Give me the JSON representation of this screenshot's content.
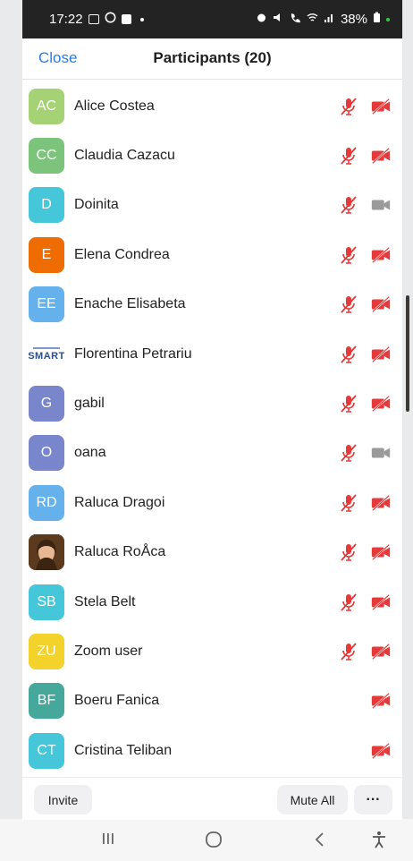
{
  "status_bar": {
    "time": "17:22",
    "battery": "38%"
  },
  "header": {
    "close_label": "Close",
    "title": "Participants (20)"
  },
  "participants": [
    {
      "initials": "AC",
      "name": "Alice Costea",
      "color": "#a6d276",
      "mic": "muted",
      "video": "off"
    },
    {
      "initials": "CC",
      "name": "Claudia Cazacu",
      "color": "#7cc47b",
      "mic": "muted",
      "video": "off"
    },
    {
      "initials": "D",
      "name": "Doinita",
      "color": "#45c6d9",
      "mic": "muted",
      "video": "on"
    },
    {
      "initials": "E",
      "name": "Elena Condrea",
      "color": "#ef6c00",
      "mic": "muted",
      "video": "off"
    },
    {
      "initials": "EE",
      "name": "Enache Elisabeta",
      "color": "#64b1ec",
      "mic": "muted",
      "video": "off"
    },
    {
      "initials": "SMART",
      "name": "Florentina Petrariu",
      "color": "#ffffff",
      "mic": "muted",
      "video": "off"
    },
    {
      "initials": "G",
      "name": "gabil",
      "color": "#7986cb",
      "mic": "muted",
      "video": "off"
    },
    {
      "initials": "O",
      "name": "oana",
      "color": "#7986cb",
      "mic": "muted",
      "video": "on"
    },
    {
      "initials": "RD",
      "name": "Raluca Dragoi",
      "color": "#64b1ec",
      "mic": "muted",
      "video": "off"
    },
    {
      "initials": "",
      "name": "Raluca RoÅca",
      "color": "#6d4a2a",
      "mic": "muted",
      "video": "off"
    },
    {
      "initials": "SB",
      "name": "Stela Belt",
      "color": "#45c6d9",
      "mic": "muted",
      "video": "off"
    },
    {
      "initials": "ZU",
      "name": "Zoom user",
      "color": "#f3d22b",
      "mic": "muted",
      "video": "off"
    },
    {
      "initials": "BF",
      "name": "Boeru Fanica",
      "color": "#46a89a",
      "mic": "none",
      "video": "off"
    },
    {
      "initials": "CT",
      "name": "Cristina Teliban",
      "color": "#45c6d9",
      "mic": "none",
      "video": "off"
    }
  ],
  "footer": {
    "invite_label": "Invite",
    "mute_all_label": "Mute All",
    "more_label": "···"
  },
  "colors": {
    "accent": "#2b7de9",
    "muted_red": "#e5393a",
    "video_gray": "#9a9a9a"
  }
}
